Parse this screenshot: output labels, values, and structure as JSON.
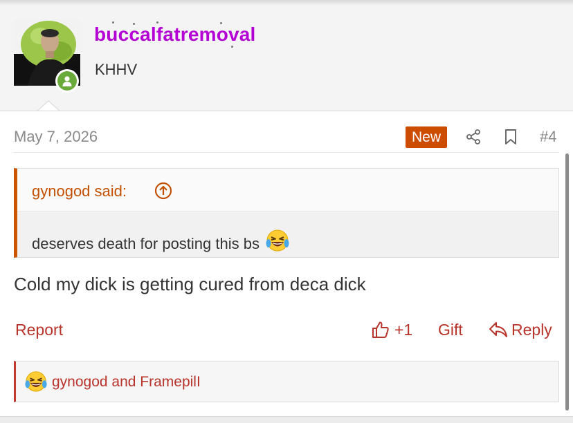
{
  "user": {
    "username": "buccalfatremoval",
    "title": "KHHV",
    "avatar_icon": "avatar-photo",
    "status_icon": "online-user-icon"
  },
  "post": {
    "date": "May 7, 2026",
    "new_label": "New",
    "number": "#4",
    "share_icon": "share-icon",
    "bookmark_icon": "bookmark-icon"
  },
  "quote": {
    "author": "gynogod said:",
    "text": "deserves death for posting this bs",
    "emoji": "crying-laughing-emoji"
  },
  "message": "Cold my dick is getting cured from deca dick",
  "actions": {
    "report": "Report",
    "like_count": "+1",
    "gift": "Gift",
    "reply": "Reply"
  },
  "reactions": {
    "emoji": "crying-laughing-emoji",
    "text": "gynogod and FramepilI"
  },
  "colors": {
    "username": "#b400d4",
    "accent": "#cc4d00",
    "action": "#b8332a"
  }
}
